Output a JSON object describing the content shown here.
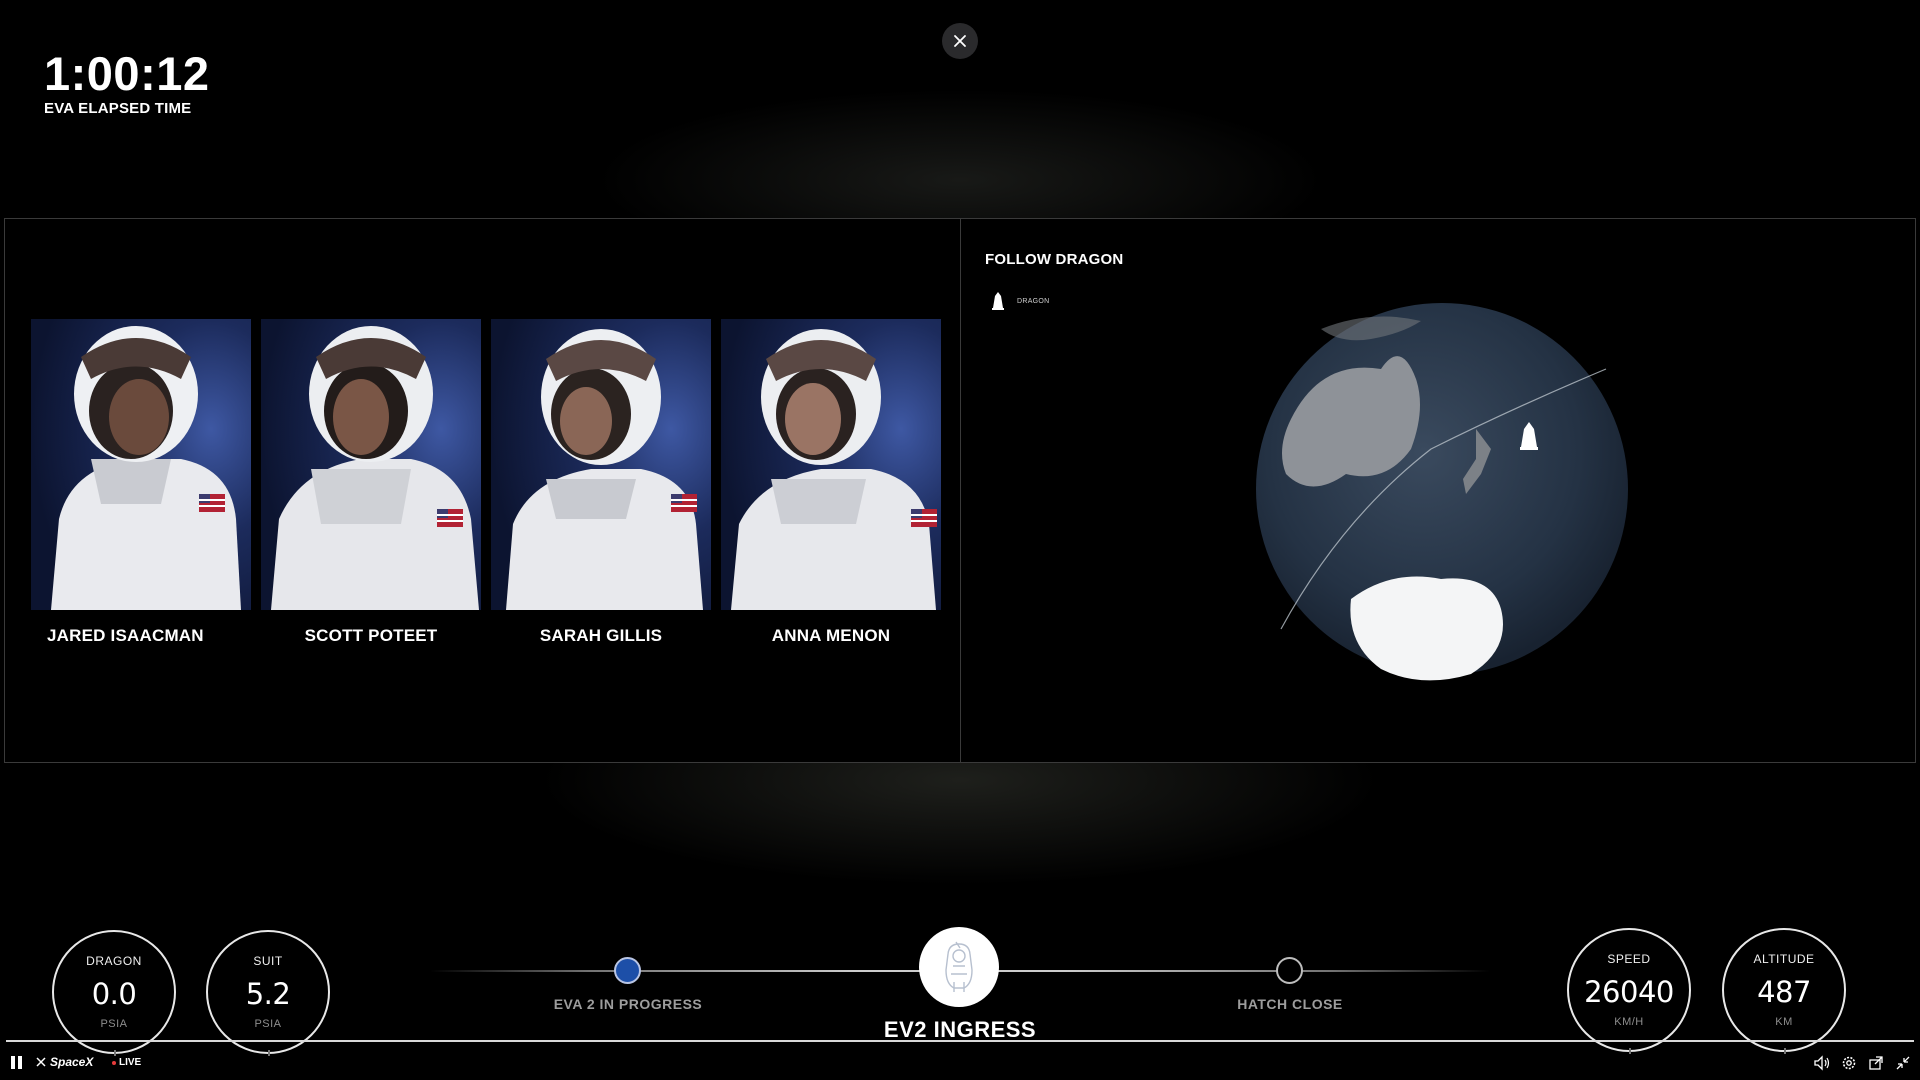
{
  "eva": {
    "elapsed_time": "1:00:12",
    "elapsed_label": "EVA ELAPSED TIME"
  },
  "crew": [
    {
      "name": "JARED ISAACMAN"
    },
    {
      "name": "SCOTT POTEET"
    },
    {
      "name": "SARAH GILLIS"
    },
    {
      "name": "ANNA MENON"
    }
  ],
  "tracker": {
    "title": "FOLLOW DRAGON",
    "legend_label": "DRAGON"
  },
  "gauges": {
    "dragon": {
      "title": "DRAGON",
      "value": "0.0",
      "unit": "PSIA"
    },
    "suit": {
      "title": "SUIT",
      "value": "5.2",
      "unit": "PSIA"
    },
    "speed": {
      "title": "SPEED",
      "value": "26040",
      "unit": "KM/H"
    },
    "altitude": {
      "title": "ALTITUDE",
      "value": "487",
      "unit": "KM"
    }
  },
  "timeline": {
    "previous_step": "EVA 2 IN PROGRESS",
    "current_step": "EV2 INGRESS",
    "next_step": "HATCH CLOSE"
  },
  "player": {
    "brand": "SpaceX",
    "live_label": "LIVE"
  },
  "colors": {
    "background": "#000000",
    "progress_node": "#1d4fa8",
    "live_dot": "#e63b3b"
  }
}
